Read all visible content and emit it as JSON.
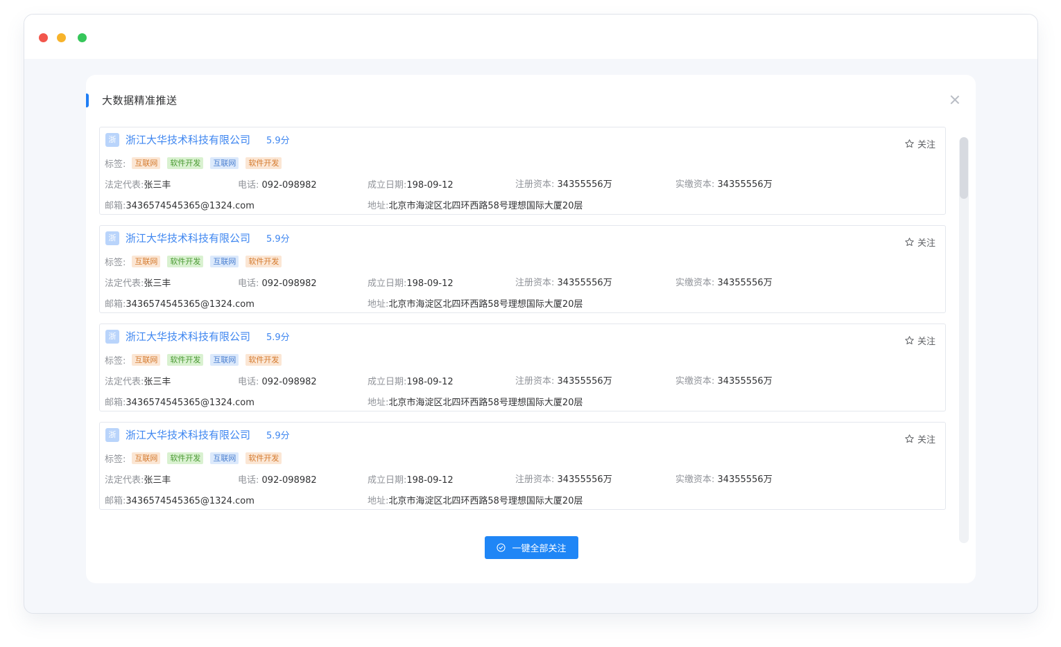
{
  "panel": {
    "title": "大数据精准推送",
    "follow_all_label": "一键全部关注"
  },
  "labels": {
    "tags": "标签:",
    "legal_rep": "法定代表:",
    "phone": "电话:",
    "founded": "成立日期:",
    "reg_capital": "注册资本:",
    "paid_capital": "实缴资本:",
    "email": "邮箱:",
    "address": "地址:",
    "follow": "关注"
  },
  "colors": {
    "accent": "#1f86f6",
    "company_link": "#3e86f0",
    "tag_orange": "#fbe6d4",
    "tag_green": "#d9f1d0",
    "tag_blue": "#dce9fb"
  },
  "companies": [
    {
      "badge": "浙",
      "name": "浙江大华技术科技有限公司",
      "score": "5.9分",
      "tags": [
        {
          "text": "互联网",
          "color": "orange"
        },
        {
          "text": "软件开发",
          "color": "green"
        },
        {
          "text": "互联网",
          "color": "blue"
        },
        {
          "text": "软件开发",
          "color": "orange"
        }
      ],
      "legal_rep": "张三丰",
      "phone": "092-098982",
      "founded": "198-09-12",
      "reg_capital": "34355556万",
      "paid_capital": "34355556万",
      "email": "3436574545365@1324.com",
      "address": "北京市海淀区北四环西路58号理想国际大厦20层"
    },
    {
      "badge": "浙",
      "name": "浙江大华技术科技有限公司",
      "score": "5.9分",
      "tags": [
        {
          "text": "互联网",
          "color": "orange"
        },
        {
          "text": "软件开发",
          "color": "green"
        },
        {
          "text": "互联网",
          "color": "blue"
        },
        {
          "text": "软件开发",
          "color": "orange"
        }
      ],
      "legal_rep": "张三丰",
      "phone": "092-098982",
      "founded": "198-09-12",
      "reg_capital": "34355556万",
      "paid_capital": "34355556万",
      "email": "3436574545365@1324.com",
      "address": "北京市海淀区北四环西路58号理想国际大厦20层"
    },
    {
      "badge": "浙",
      "name": "浙江大华技术科技有限公司",
      "score": "5.9分",
      "tags": [
        {
          "text": "互联网",
          "color": "orange"
        },
        {
          "text": "软件开发",
          "color": "green"
        },
        {
          "text": "互联网",
          "color": "blue"
        },
        {
          "text": "软件开发",
          "color": "orange"
        }
      ],
      "legal_rep": "张三丰",
      "phone": "092-098982",
      "founded": "198-09-12",
      "reg_capital": "34355556万",
      "paid_capital": "34355556万",
      "email": "3436574545365@1324.com",
      "address": "北京市海淀区北四环西路58号理想国际大厦20层"
    },
    {
      "badge": "浙",
      "name": "浙江大华技术科技有限公司",
      "score": "5.9分",
      "tags": [
        {
          "text": "互联网",
          "color": "orange"
        },
        {
          "text": "软件开发",
          "color": "green"
        },
        {
          "text": "互联网",
          "color": "blue"
        },
        {
          "text": "软件开发",
          "color": "orange"
        }
      ],
      "legal_rep": "张三丰",
      "phone": "092-098982",
      "founded": "198-09-12",
      "reg_capital": "34355556万",
      "paid_capital": "34355556万",
      "email": "3436574545365@1324.com",
      "address": "北京市海淀区北四环西路58号理想国际大厦20层"
    }
  ]
}
